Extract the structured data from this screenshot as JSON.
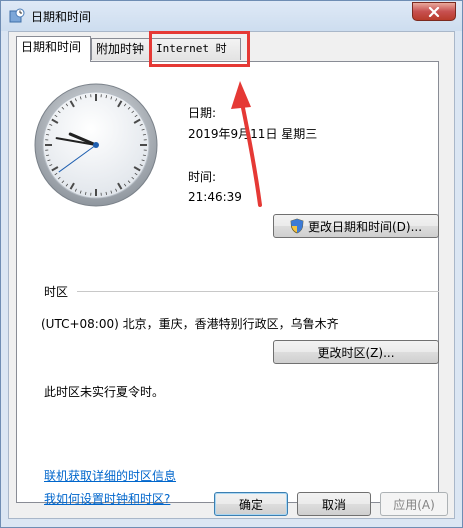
{
  "window": {
    "title": "日期和时间",
    "colors": {
      "accent": "#e53935",
      "link": "#0066cc"
    }
  },
  "tabs": [
    {
      "label": "日期和时间",
      "active": true
    },
    {
      "label": "附加时钟",
      "active": false
    },
    {
      "label": "Internet 时间",
      "active": false
    }
  ],
  "datetime": {
    "date_label": "日期:",
    "date_value": "2019年9月11日 星期三",
    "time_label": "时间:",
    "time_value": "21:46:39",
    "change_button": "更改日期和时间(D)..."
  },
  "timezone": {
    "section_label": "时区",
    "value": "(UTC+08:00) 北京，重庆，香港特别行政区，乌鲁木齐",
    "change_button": "更改时区(Z)...",
    "dst_note": "此时区未实行夏令时。"
  },
  "links": [
    "联机获取详细的时区信息",
    "我如何设置时钟和时区?"
  ],
  "footer": {
    "ok": "确定",
    "cancel": "取消",
    "apply": "应用(A)"
  },
  "clock": {
    "hour": 21,
    "minute": 46,
    "second": 39
  },
  "annotation": {
    "icon": "red-arrow-icon"
  }
}
